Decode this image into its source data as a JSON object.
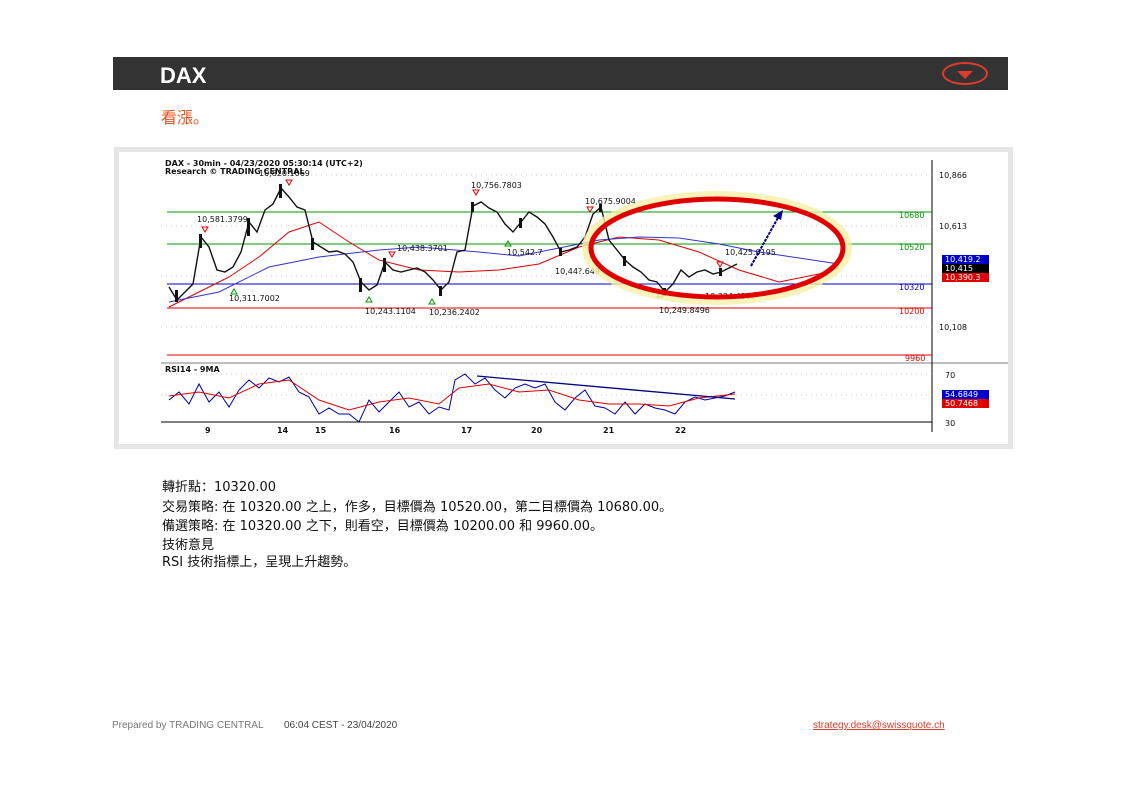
{
  "header": {
    "title": "DAX"
  },
  "bias": "看漲。",
  "chart": {
    "title_line1": "DAX - 30min - 04/23/2020 05:30:14 (UTC+2)",
    "title_line2": "Research © TRADING CENTRAL",
    "price_axis": [
      "10,866",
      "10,613",
      "10,108"
    ],
    "level_labels": {
      "l10680": "10680",
      "l10520": "10520",
      "l10320": "10320",
      "l10200": "10200",
      "l9960": "9960"
    },
    "current_price_tags": [
      "10,419.2",
      "10,415",
      "10,390.3"
    ],
    "annotations": {
      "a1": "10,581.3799",
      "a2": "10,820.1069",
      "a3": "10,311.7002",
      "a4": "10,243.1104",
      "a5": "10,236.2402",
      "a6": "10,438.3701",
      "a7": "10,756.7803",
      "a8": "10,542.7",
      "a9": "10,675.9004",
      "a10": "10,44?.649",
      "a11": "10,425.0195",
      "a12": "10,324.4102",
      "a13": "10,249.8496"
    },
    "rsi_label": "RSI14 - 9MA",
    "rsi_axis": [
      "70",
      "30"
    ],
    "rsi_tags": [
      "54.6849",
      "50.7468"
    ],
    "x_ticks": [
      "9",
      "14",
      "15",
      "16",
      "17",
      "20",
      "21",
      "22"
    ],
    "colors": {
      "up_level": "#009900",
      "down_level": "#e00000",
      "ellipse": "#e00000",
      "arrow": "#000080",
      "ma_red": "#e00000",
      "ma_blue": "#3333cc",
      "rsi": "#0000aa"
    }
  },
  "analysis": {
    "pivot": "轉折點：10320.00",
    "strategy": "交易策略: 在 10320.00 之上，作多，目標價為 10520.00，第二目標價為 10680.00。",
    "alternative": "備選策略: 在 10320.00 之下，則看空，目標價為 10200.00 和 9960.00。",
    "comment_title": "技術意見",
    "comment": "RSI 技術指標上，呈現上升趨勢。"
  },
  "footer": {
    "prepared_by": "Prepared by TRADING CENTRAL",
    "timestamp": "06:04 CEST - 23/04/2020",
    "email": "strategy.desk@swissquote.ch"
  }
}
